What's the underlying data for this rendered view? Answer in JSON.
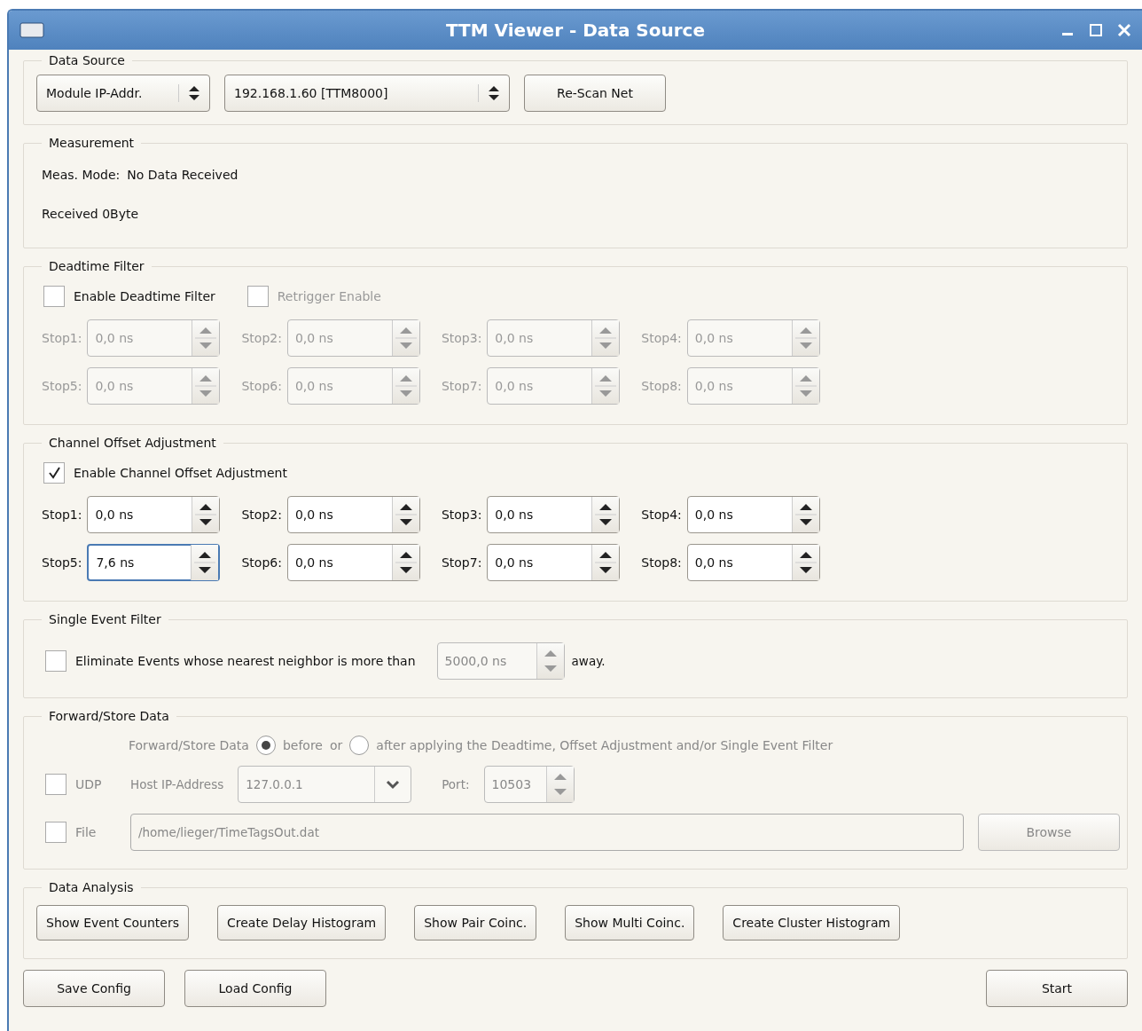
{
  "window": {
    "title": "TTM Viewer - Data Source"
  },
  "data_source": {
    "title": "Data Source",
    "mode_select": "Module IP-Addr.",
    "address_select": "192.168.1.60 [TTM8000]",
    "rescan_button": "Re-Scan Net"
  },
  "measurement": {
    "title": "Measurement",
    "mode_label": "Meas. Mode:",
    "mode_value": "No Data Received",
    "received": "Received 0Byte"
  },
  "deadtime_filter": {
    "title": "Deadtime Filter",
    "disabled": true,
    "checkboxes": [
      {
        "label": "Enable Deadtime Filter",
        "checked": false,
        "disabled": false
      },
      {
        "label": "Retrigger Enable",
        "checked": false,
        "disabled": true
      }
    ],
    "fields": [
      {
        "label": "Stop1:",
        "value": "0,0 ns",
        "focused": false
      },
      {
        "label": "Stop2:",
        "value": "0,0 ns",
        "focused": false
      },
      {
        "label": "Stop3:",
        "value": "0,0 ns",
        "focused": false
      },
      {
        "label": "Stop4:",
        "value": "0,0 ns",
        "focused": false
      },
      {
        "label": "Stop5:",
        "value": "0,0 ns",
        "focused": false
      },
      {
        "label": "Stop6:",
        "value": "0,0 ns",
        "focused": false
      },
      {
        "label": "Stop7:",
        "value": "0,0 ns",
        "focused": false
      },
      {
        "label": "Stop8:",
        "value": "0,0 ns",
        "focused": false
      }
    ]
  },
  "channel_offset": {
    "title": "Channel Offset Adjustment",
    "disabled": false,
    "checkboxes": [
      {
        "label": "Enable Channel Offset Adjustment",
        "checked": true,
        "disabled": false
      }
    ],
    "fields": [
      {
        "label": "Stop1:",
        "value": "0,0 ns",
        "focused": false
      },
      {
        "label": "Stop2:",
        "value": "0,0 ns",
        "focused": false
      },
      {
        "label": "Stop3:",
        "value": "0,0 ns",
        "focused": false
      },
      {
        "label": "Stop4:",
        "value": "0,0 ns",
        "focused": false
      },
      {
        "label": "Stop5:",
        "value": "7,6 ns",
        "focused": true
      },
      {
        "label": "Stop6:",
        "value": "0,0 ns",
        "focused": false
      },
      {
        "label": "Stop7:",
        "value": "0,0 ns",
        "focused": false
      },
      {
        "label": "Stop8:",
        "value": "0,0 ns",
        "focused": false
      }
    ]
  },
  "single_event_filter": {
    "title": "Single Event Filter",
    "checkbox": {
      "label": "Eliminate Events whose nearest neighbor is more than",
      "checked": false
    },
    "distance": {
      "value": "5000,0 ns",
      "disabled": true
    },
    "suffix": "away."
  },
  "forward_store": {
    "title": "Forward/Store Data",
    "disabled": true,
    "prefix": "Forward/Store Data",
    "options": [
      {
        "label": "before",
        "selected": true
      },
      {
        "label": "after applying the Deadtime, Offset Adjustment and/or Single Event Filter",
        "selected": false
      }
    ],
    "or_text": "or",
    "udp": {
      "label": "UDP",
      "checked": false
    },
    "host_label": "Host IP-Address",
    "host_value": "127.0.0.1",
    "port_label": "Port:",
    "port_value": "10503",
    "file": {
      "label": "File",
      "checked": false
    },
    "path": "/home/lieger/TimeTagsOut.dat",
    "browse_button": "Browse"
  },
  "data_analysis": {
    "title": "Data Analysis",
    "buttons": [
      "Show Event Counters",
      "Create Delay Histogram",
      "Show Pair Coinc.",
      "Show Multi Coinc.",
      "Create Cluster Histogram"
    ]
  },
  "footer": {
    "left_buttons": [
      "Save Config",
      "Load Config"
    ],
    "start_button": "Start"
  }
}
